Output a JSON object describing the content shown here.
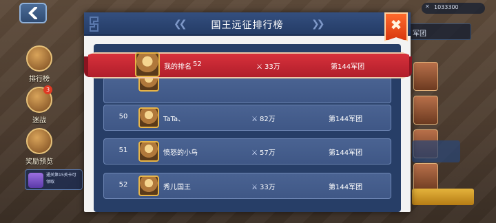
{
  "title": "国王远征排行榜",
  "background": {
    "side_buttons": [
      {
        "label": "排行榜",
        "badge": ""
      },
      {
        "label": "迷战",
        "badge": "3"
      },
      {
        "label": "奖励预览",
        "badge": ""
      }
    ],
    "notice_text": "通关第15关卡可领取",
    "resource_value": "1033300",
    "right_panel_text": "军团"
  },
  "my_rank": {
    "label": "我的排名",
    "rank": "52",
    "power": "33万",
    "legion": "第144军团"
  },
  "rows": [
    {
      "rank": "50",
      "name": "TaTa、",
      "power": "82万",
      "legion": "第144军团"
    },
    {
      "rank": "51",
      "name": "愤怒的小鸟",
      "power": "57万",
      "legion": "第144军团"
    },
    {
      "rank": "52",
      "name": "秀儿国王",
      "power": "33万",
      "legion": "第144军团"
    }
  ],
  "icons": {
    "back": "back-arrow-icon",
    "close": "close-icon",
    "power": "crossed-swords-icon",
    "nav_left": "double-chevron-left-icon",
    "nav_right": "double-chevron-right-icon"
  },
  "colors": {
    "header": "#2c4573",
    "list_bg": "#273e67",
    "row": "#455d8c",
    "banner": "#c92633",
    "close": "#f0531d"
  }
}
